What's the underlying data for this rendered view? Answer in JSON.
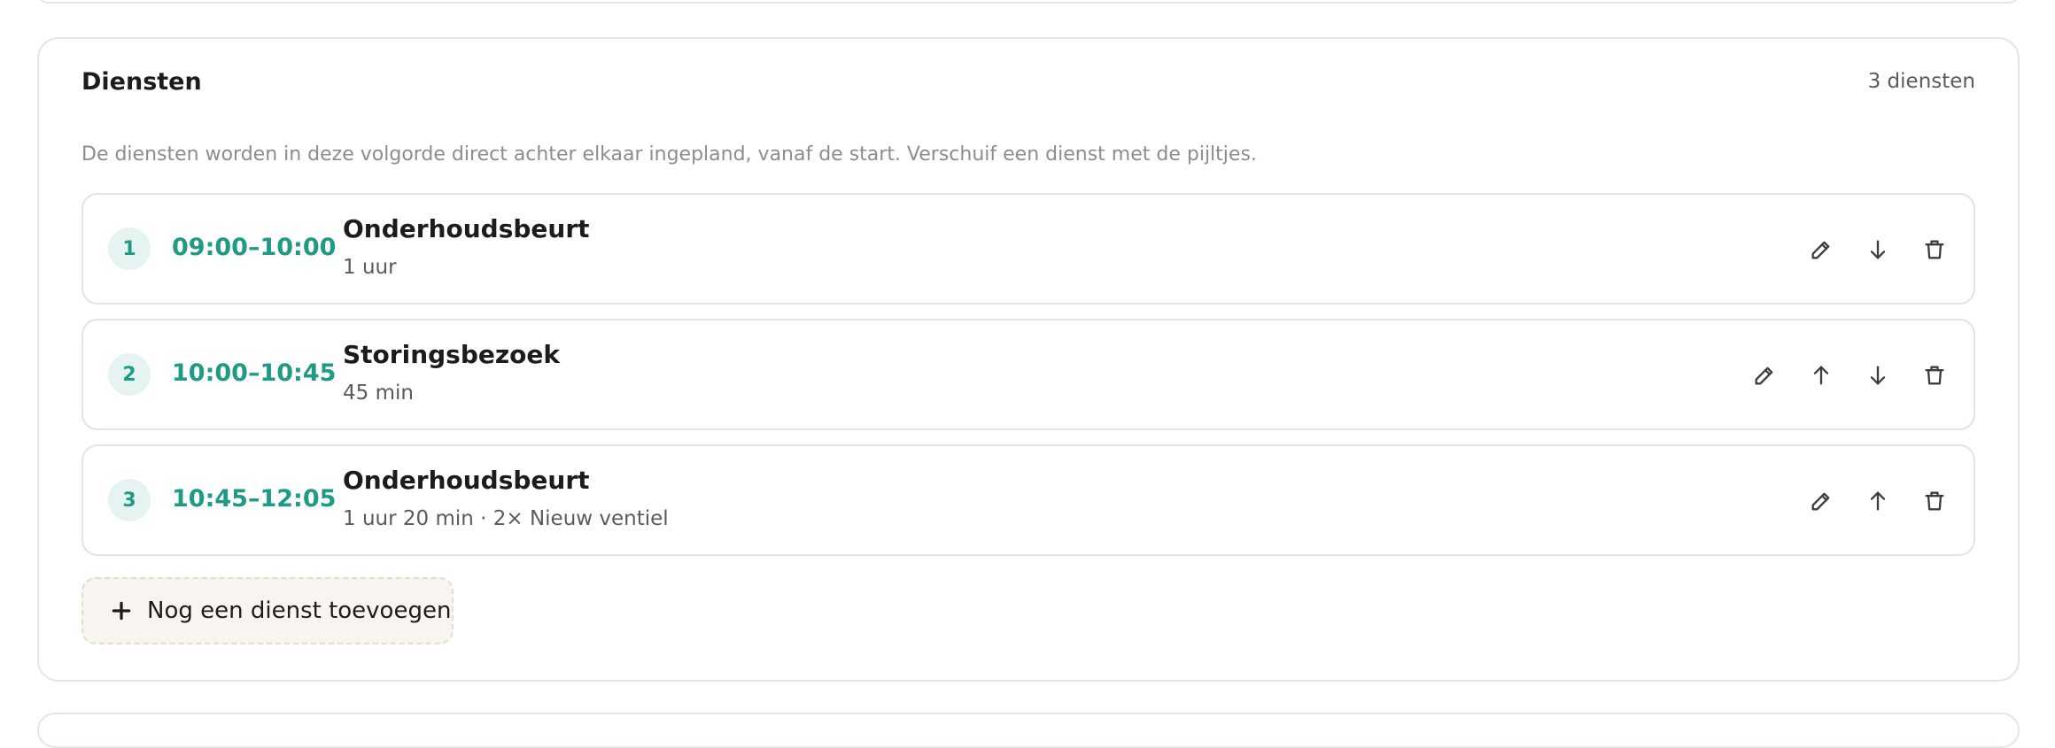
{
  "card": {
    "title": "Diensten",
    "count": "3 diensten",
    "description": "De diensten worden in deze volgorde direct achter elkaar ingepland, vanaf de start. Verschuif een dienst met de pijltjes."
  },
  "services": [
    {
      "index": "1",
      "time": "09:00–10:00",
      "name": "Onderhoudsbeurt",
      "meta": "1 uur",
      "can_move_up": false,
      "can_move_down": true
    },
    {
      "index": "2",
      "time": "10:00–10:45",
      "name": "Storingsbezoek",
      "meta": "45 min",
      "can_move_up": true,
      "can_move_down": true
    },
    {
      "index": "3",
      "time": "10:45–12:05",
      "name": "Onderhoudsbeurt",
      "meta": "1 uur 20 min · 2× Nieuw ventiel",
      "can_move_up": true,
      "can_move_down": false
    }
  ],
  "add_button": {
    "label": "Nog een dienst toevoegen",
    "icon": "plus-icon"
  },
  "icons": {
    "edit": "pencil-icon",
    "up": "arrow-up-icon",
    "down": "arrow-down-icon",
    "delete": "trash-icon"
  },
  "colors": {
    "accent": "#1f9a84",
    "accent_bg": "#e6f4f1",
    "border": "#e4e3df",
    "add_bg": "#f8f5f0"
  }
}
